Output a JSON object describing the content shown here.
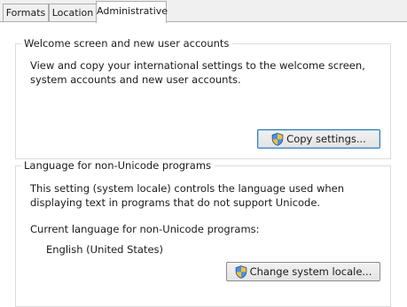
{
  "tabs": [
    {
      "label": "Formats",
      "active": false
    },
    {
      "label": "Location",
      "active": false
    },
    {
      "label": "Administrative",
      "active": true
    }
  ],
  "welcome_group": {
    "title": "Welcome screen and new user accounts",
    "description": "View and copy your international settings to the welcome screen, system accounts and new user accounts.",
    "button_label": "Copy settings...",
    "button_icon": "uac-shield-icon"
  },
  "unicode_group": {
    "title": "Language for non-Unicode programs",
    "description": "This setting (system locale) controls the language used when displaying text in programs that do not support Unicode.",
    "current_label": "Current language for non-Unicode programs:",
    "current_value": "English (United States)",
    "button_label": "Change system locale...",
    "button_icon": "uac-shield-icon"
  },
  "colors": {
    "background": "#ffffff",
    "tab_strip": "#f0f0f0",
    "group_border": "#dcdcdc",
    "focus_border": "#3c7fb1"
  }
}
